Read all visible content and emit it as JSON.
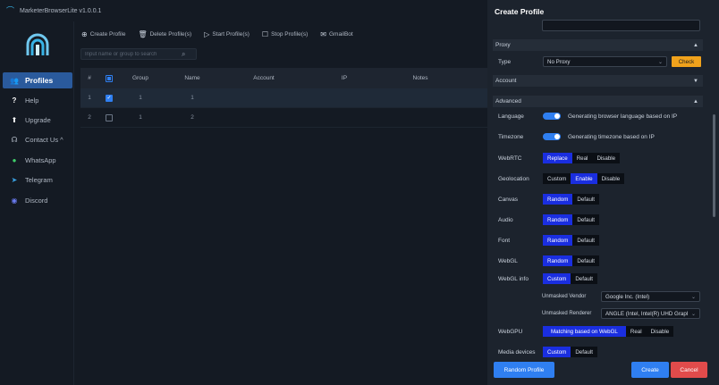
{
  "window": {
    "title": "MarketerBrowserLite v1.0.0.1"
  },
  "sidebar": {
    "items": [
      {
        "label": "Profiles",
        "icon": "users-icon"
      },
      {
        "label": "Help",
        "icon": "question-icon"
      },
      {
        "label": "Upgrade",
        "icon": "upgrade-icon"
      },
      {
        "label": "Contact Us ^",
        "icon": "headset-icon"
      },
      {
        "label": "WhatsApp",
        "icon": "whatsapp-icon"
      },
      {
        "label": "Telegram",
        "icon": "telegram-icon"
      },
      {
        "label": "Discord",
        "icon": "discord-icon"
      }
    ]
  },
  "toolbar": {
    "create": "Create Profile",
    "delete": "Delete Profile(s)",
    "start": "Start Profile(s)",
    "stop": "Stop Profile(s)",
    "gmailbot": "GmailBot"
  },
  "search": {
    "placeholder": "Input name or group to search"
  },
  "table": {
    "headers": {
      "num": "#",
      "group": "Group",
      "name": "Name",
      "account": "Account",
      "ip": "IP",
      "notes": "Notes"
    },
    "rows": [
      {
        "num": "1",
        "group": "1",
        "name": "1",
        "checked": true
      },
      {
        "num": "2",
        "group": "1",
        "name": "2",
        "checked": false
      }
    ]
  },
  "panel": {
    "title": "Create Profile",
    "proxy": {
      "section": "Proxy",
      "type_label": "Type",
      "type_value": "No Proxy",
      "check_label": "Check"
    },
    "account": {
      "section": "Account"
    },
    "advanced": {
      "section": "Advanced",
      "language": {
        "label": "Language",
        "text": "Generating browser language based on IP"
      },
      "timezone": {
        "label": "Timezone",
        "text": "Generating timezone based on IP"
      },
      "webrtc": {
        "label": "WebRTC",
        "options": [
          "Replace",
          "Real",
          "Disable"
        ],
        "selected": "Replace"
      },
      "geolocation": {
        "label": "Geolocation",
        "options": [
          "Custom",
          "Enable",
          "Disable"
        ],
        "selected": "Enable"
      },
      "canvas": {
        "label": "Canvas",
        "options": [
          "Random",
          "Default"
        ],
        "selected": "Random"
      },
      "audio": {
        "label": "Audio",
        "options": [
          "Random",
          "Default"
        ],
        "selected": "Random"
      },
      "font": {
        "label": "Font",
        "options": [
          "Random",
          "Default"
        ],
        "selected": "Random"
      },
      "webgl": {
        "label": "WebGL",
        "options": [
          "Random",
          "Default"
        ],
        "selected": "Random"
      },
      "webgl_info": {
        "label": "WebGL info",
        "options": [
          "Custom",
          "Default"
        ],
        "selected": "Custom"
      },
      "vendor": {
        "label": "Unmasked Vendor",
        "value": "Google Inc. (Intel)"
      },
      "renderer": {
        "label": "Unmasked Renderer",
        "value": "ANGLE (Intel, Intel(R) UHD Grapl"
      },
      "webgpu": {
        "label": "WebGPU",
        "options": [
          "Matching based on WebGL",
          "Real",
          "Disable"
        ],
        "selected": "Matching based on WebGL"
      },
      "media": {
        "label": "Media devices",
        "options": [
          "Custom",
          "Default"
        ],
        "selected": "Custom"
      }
    },
    "buttons": {
      "random": "Random Profile",
      "create": "Create",
      "cancel": "Cancel"
    }
  },
  "colors": {
    "accent": "#2f7ff1",
    "selected_segment": "#1a2ee0",
    "check_button": "#f0a21c",
    "cancel": "#e14b4b",
    "active_nav": "#2a5a9c"
  }
}
